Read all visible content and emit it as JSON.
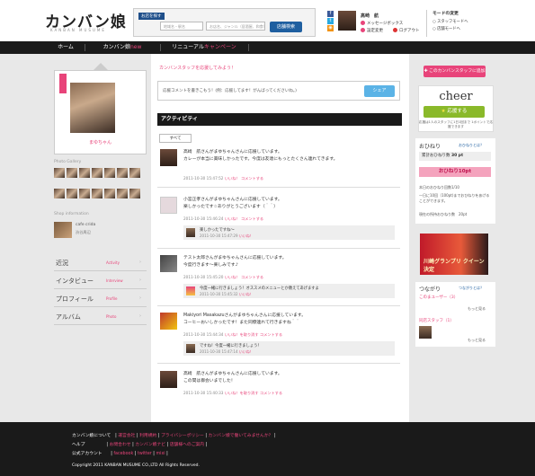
{
  "header": {
    "logo": "カンバン娘",
    "logo_sub": "KANBAN MUSUME",
    "search_tag": "お店を探す",
    "search_placeholders": [
      "地域名・駅名",
      "お店名、ジャンル（居酒屋、和食）など",
      "検索"
    ],
    "search_button": "店舗検索",
    "user_name": "高崎　航",
    "link_messages": "メッセージボックス",
    "link_settings": "設定変更",
    "link_logout": "ログアウト",
    "mode_title": "モードの変更",
    "mode_staff": "スタッフモードへ",
    "mode_normal": "店舗モードへ"
  },
  "nav": {
    "home": "ホーム",
    "kanban": "カンバン娘",
    "kanban_new": "new",
    "renewal": "リニューアル",
    "campaign": "キャンペーン"
  },
  "left": {
    "ribbon": "カンバン娘",
    "profile_name": "まゆちゃん",
    "photo_gallery": "Photo Gallery",
    "shop_info": "Shop information",
    "shop_name": "cafe crida",
    "shop_area": "渋谷周辺",
    "menu": [
      {
        "jp": "近況",
        "en": "Activity"
      },
      {
        "jp": "インタビュー",
        "en": "Interview"
      },
      {
        "jp": "プロフィール",
        "en": "Profile"
      },
      {
        "jp": "アルバム",
        "en": "Photo"
      }
    ]
  },
  "center": {
    "cheer_label": "カンバンスタッフを応援してみよう！",
    "cheer_input": "応援コメントを書きこもう！(例：応援してます！がんばってくださいね。)",
    "share": "シェア",
    "activity_title": "アクティビティ",
    "filter": "すべて",
    "posts": [
      {
        "text": "高崎　航さんがまゆちゃんさんに応援しています。",
        "body": "カレーが本当に美味しかったです。今度は友達にもっとたくさん連れてきます。",
        "meta": "2011-10-30 15:47:52",
        "like": "いいね！",
        "comment": "コメントする"
      },
      {
        "text": "小宮正孝さんがまゆちゃんさんに応援しています。",
        "body": "楽しかったです☆ありがとうございます（＾＾）",
        "meta": "2011-10-30 15:46:24",
        "like": "いいね！",
        "comment": "コメントする",
        "reply": {
          "text": "楽しかったですね〜",
          "meta": "2011-10-30 15:47:29",
          "like": "いいね！"
        }
      },
      {
        "text": "テスト太郎さんがまゆちゃんさんに応援しています。",
        "body": "今度行きます〜楽しみです♪",
        "meta": "2011-10-30 15:45:20",
        "like": "いいね！",
        "comment": "コメントする",
        "reply": {
          "text": "今度一緒に行きましょう！オススメのメニューとか教えてあげますよ",
          "meta": "2011-10-30 15:45:32",
          "like": "いいね！"
        }
      },
      {
        "text": "Makiyori Masakazuさんがまゆちゃんさんに応援しています。",
        "body": "コーヒーおいしかったです！また同僚連れて行きますね＾＾",
        "meta": "2011-10-30 15:44:34",
        "like": "いいね！を取り消す",
        "comment": "コメントする",
        "reply": {
          "text": "ですね！今度一緒に行きましょう！",
          "meta": "2011-10-30 15:47:14",
          "like": "いいね！"
        }
      },
      {
        "text": "高崎　航さんがまゆちゃんさんに応援しています。",
        "body": "この間は御会いまでした！",
        "meta": "2011-10-30 15:40:33",
        "like": "いいね！を取り消す",
        "comment": "コメントする"
      }
    ]
  },
  "right": {
    "staff_button": "このカンバンスタッフに追加",
    "cheer_title": "cheer",
    "cheer_go": "応援する",
    "cheer_note": "応援は1人のスタッフに1日1回まで 1ポイントで応援できます",
    "ohineri": "おひねり",
    "ohineri_link": "おひねりとは？",
    "ohineri_total_label": "累計おひねり数",
    "ohineri_total": "30 pt",
    "ohineri_btn": "おひねり10pt",
    "ohineri_note1": "本日のおひねり回数1/10",
    "ohineri_note2": "一日に10回（100pt)までおひねりをあげることができます。",
    "ohineri_note3": "現在の所持おひねり数　20pt",
    "banner_text": "川崎グランプリ クイーン決定",
    "tsunagari": "つながり",
    "tsunagari_link": "つながりとは？",
    "fans": "このまユーザー（3）",
    "staff": "同店スタッフ（1）",
    "more": "もっと見る"
  },
  "footer": {
    "row1_label": "カンバン娘について",
    "row1_links": [
      "運営会社",
      "利用規約",
      "プライバシーポリシー",
      "カンバン娘で働いてみませんか？"
    ],
    "row2_label": "ヘルプ",
    "row2_links": [
      "お問合わせ",
      "カンバン娘ナビ",
      "店舗様へのご案内"
    ],
    "row3_label": "公式アカウント",
    "row3_links": [
      "facebook",
      "twitter",
      "mixi"
    ],
    "copyright": "Copyright 2011 KANBAN MUSUME CO.,LTD All Rights Reserved."
  },
  "colors": {
    "accent": "#e8447a",
    "nav": "#1a1a1a",
    "button_blue": "#1f5fa0",
    "cheer_green": "#8ab92a"
  }
}
